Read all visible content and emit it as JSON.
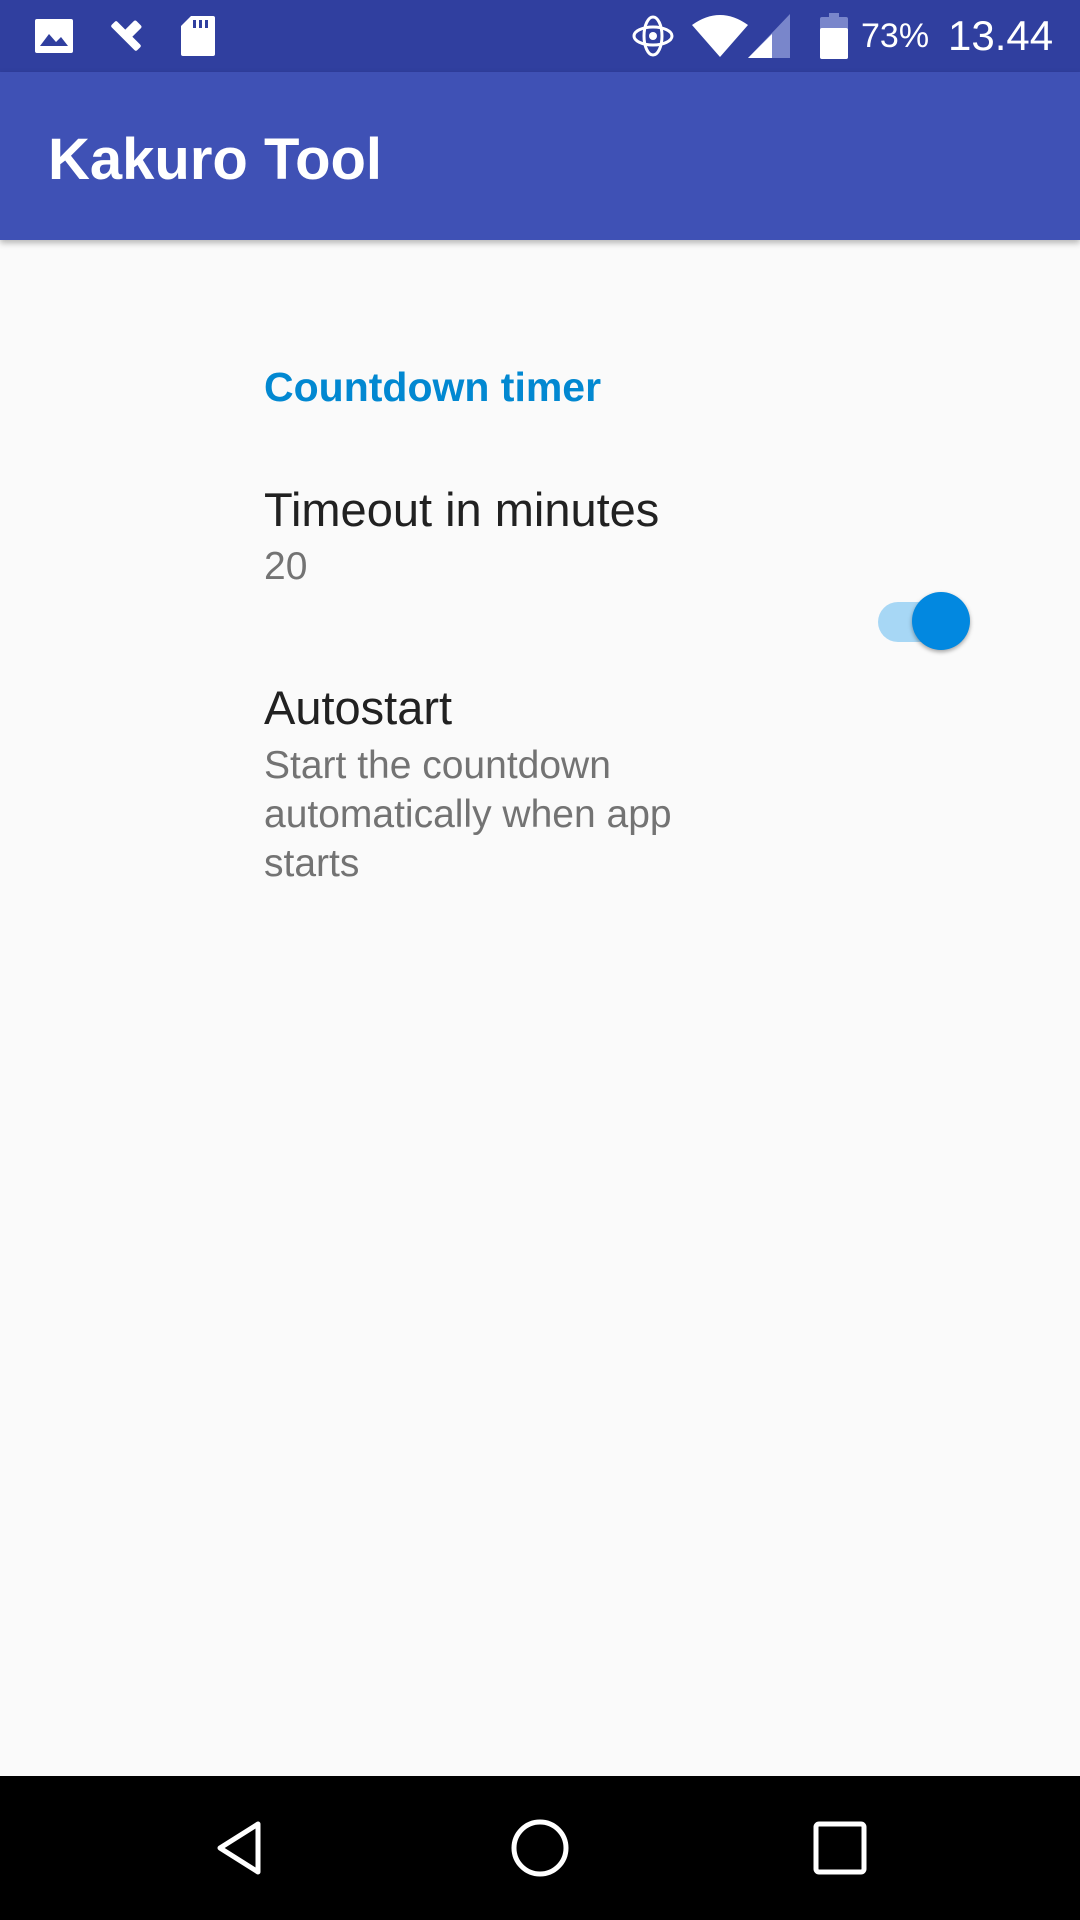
{
  "status_bar": {
    "battery_percent": "73%",
    "time": "13.44",
    "left_icons": [
      "image-icon",
      "tools-icon",
      "sd-card-icon"
    ],
    "right_icons": [
      "sync-icon",
      "wifi-icon",
      "cell-signal-icon",
      "battery-icon"
    ],
    "background_color": "#303f9f"
  },
  "app_bar": {
    "title": "Kakuro Tool",
    "background_color": "#3f51b5"
  },
  "settings": {
    "category": {
      "title": "Countdown timer",
      "color": "#0288d1"
    },
    "timeout": {
      "title": "Timeout in minutes",
      "value": "20"
    },
    "autostart": {
      "title": "Autostart",
      "summary": "Start the countdown automatically when app starts",
      "enabled": true,
      "accent_color": "#0288e0"
    }
  },
  "nav_bar": {
    "buttons": [
      "back-icon",
      "home-icon",
      "recents-icon"
    ]
  }
}
